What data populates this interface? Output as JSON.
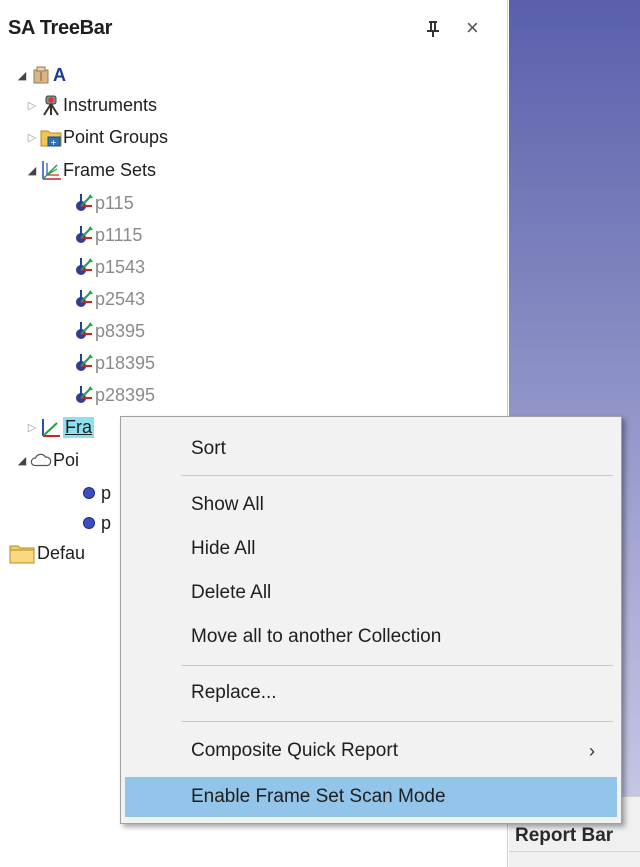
{
  "panel": {
    "title": "SA TreeBar"
  },
  "tree": {
    "root": "A",
    "instruments": "Instruments",
    "point_groups": "Point Groups",
    "frame_sets": "Frame Sets",
    "frame_set_items": [
      "p115",
      "p1115",
      "p1543",
      "p2543",
      "p8395",
      "p18395",
      "p28395"
    ],
    "frames_partial": "Fra",
    "points_partial": "Poi",
    "point_child_1": "p",
    "point_child_2": "p",
    "default_partial": "Defau"
  },
  "context_menu": {
    "sort": "Sort",
    "show_all": "Show All",
    "hide_all": "Hide All",
    "delete_all": "Delete All",
    "move_all": "Move all to another Collection",
    "replace": "Replace...",
    "composite_quick_report": "Composite Quick Report",
    "submenu_arrow": "›",
    "enable_scan_mode": "Enable Frame Set Scan Mode"
  },
  "report_bar": {
    "title": "Report Bar"
  },
  "colors": {
    "highlight": "#93c4ea",
    "selection": "#8fe0ee",
    "viewport_top": "#5a5fac"
  },
  "icons": [
    "pin-icon",
    "close-icon",
    "part-icon",
    "instrument-icon",
    "point-group-icon",
    "frame-set-icon",
    "frame-icon",
    "point-cloud-icon",
    "point-icon",
    "folder-icon"
  ]
}
